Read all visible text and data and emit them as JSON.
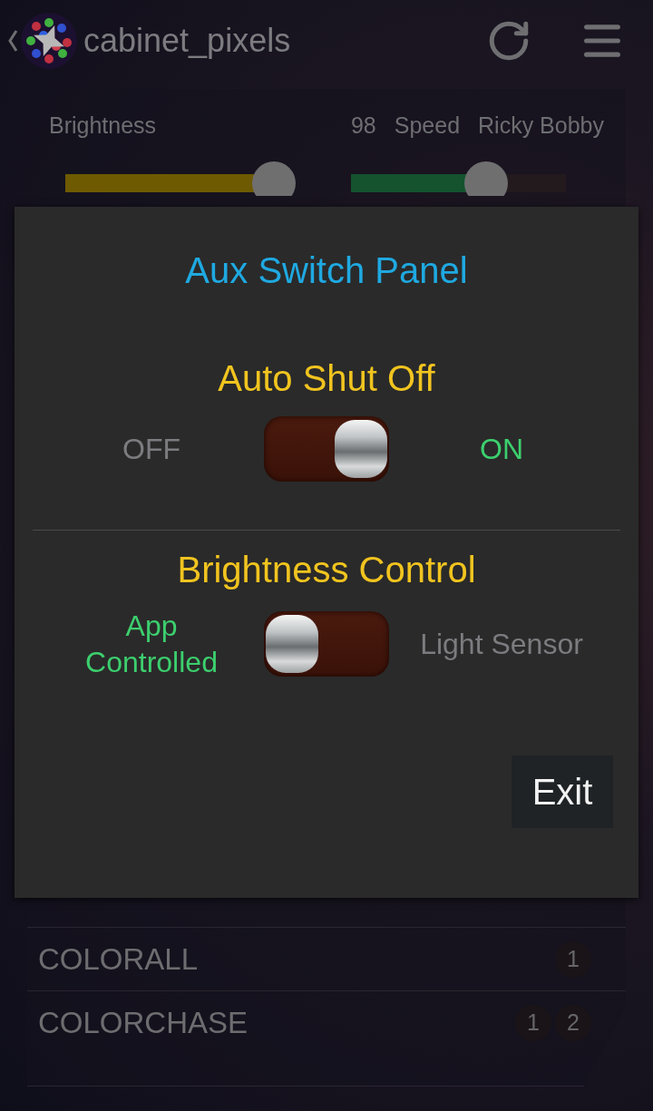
{
  "app_bar": {
    "title": "cabinet_pixels"
  },
  "controls": [
    {
      "label": "Brightness",
      "reading": "98",
      "level": 0.97,
      "color": "#6e5a00"
    },
    {
      "label": "Speed",
      "reading": "Ricky Bobby",
      "level": 0.63,
      "color": "#14532e"
    }
  ],
  "patterns": [
    {
      "name": "COLORALL",
      "badges": [
        "1"
      ]
    },
    {
      "name": "COLORCHASE",
      "badges": [
        "1",
        "2"
      ]
    }
  ],
  "dialog": {
    "title": "Aux Switch Panel",
    "switches": [
      {
        "label": "Auto Shut Off",
        "off_label": "OFF",
        "on_label": "ON",
        "on": true
      },
      {
        "label": "Brightness Control",
        "off_label": "App Controlled",
        "on_label": "Light Sensor",
        "on": false
      }
    ],
    "exit_button": "Exit"
  }
}
